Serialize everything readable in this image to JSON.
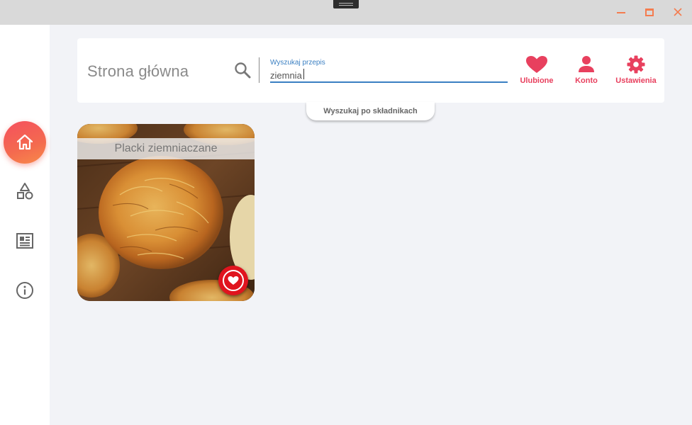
{
  "window": {
    "controls": {
      "minimize_icon": "minimize-icon",
      "maximize_icon": "maximize-icon",
      "close_icon": "close-icon"
    },
    "accent_color": "#f47c4f"
  },
  "sidebar": {
    "items": [
      {
        "icon": "home-icon",
        "active": true
      },
      {
        "icon": "shapes-icon",
        "active": false
      },
      {
        "icon": "news-icon",
        "active": false
      },
      {
        "icon": "info-icon",
        "active": false
      }
    ],
    "active_gradient": [
      "#f5505e",
      "#f88a4a"
    ]
  },
  "header": {
    "title": "Strona główna",
    "search": {
      "label": "Wyszukaj przepis",
      "value": "ziemnia",
      "icon": "search-icon"
    },
    "actions": [
      {
        "label": "Ulubione",
        "icon": "heart-icon"
      },
      {
        "label": "Konto",
        "icon": "person-icon"
      },
      {
        "label": "Ustawienia",
        "icon": "gear-icon"
      }
    ],
    "ingredients_tab": "Wyszukaj po składnikach",
    "accent_color": "#e8405e"
  },
  "recipes": [
    {
      "title": "Placki ziemniaczane",
      "favorite": true
    }
  ]
}
